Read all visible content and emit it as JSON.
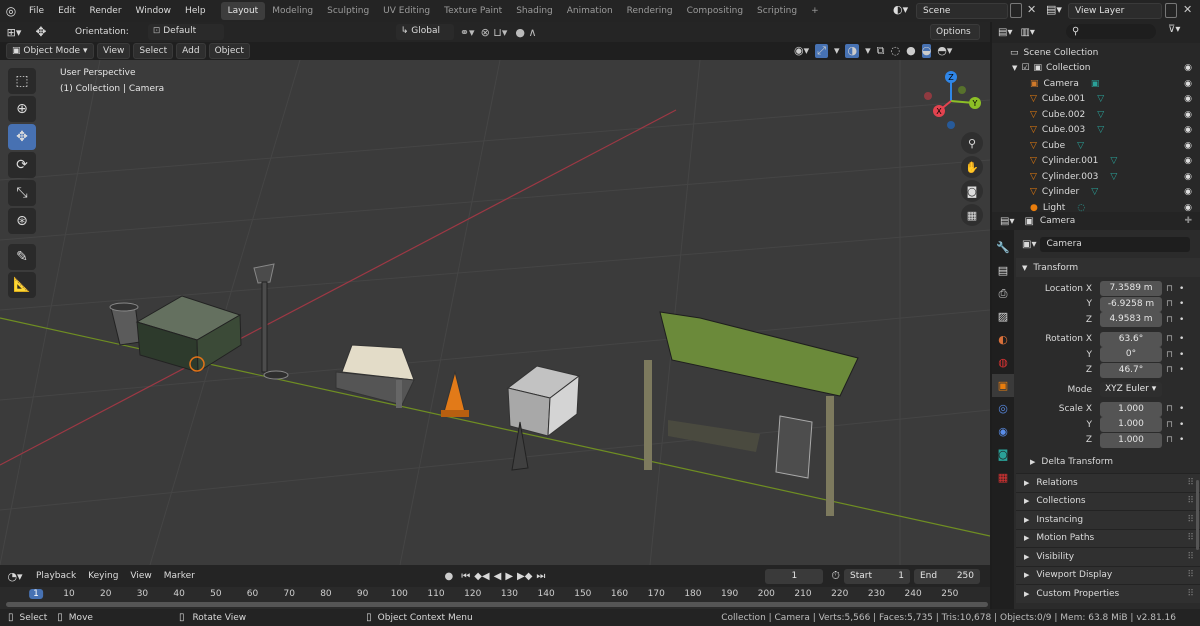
{
  "menu": [
    "File",
    "Edit",
    "Render",
    "Window",
    "Help"
  ],
  "workspaces": [
    "Layout",
    "Modeling",
    "Sculpting",
    "UV Editing",
    "Texture Paint",
    "Shading",
    "Animation",
    "Rendering",
    "Compositing",
    "Scripting"
  ],
  "active_workspace": "Layout",
  "scene": "Scene",
  "view_layer": "View Layer",
  "header": {
    "orientation_label": "Orientation:",
    "orientation_value": "Default",
    "transform_orientation": "Global",
    "options": "Options"
  },
  "mode_bar": {
    "mode": "Object Mode",
    "view": "View",
    "select": "Select",
    "add": "Add",
    "object": "Object"
  },
  "viewport": {
    "perspective": "User Perspective",
    "context": "(1) Collection | Camera"
  },
  "gizmo": {
    "z": "Z",
    "y": "Y",
    "x": "X"
  },
  "timeline": {
    "menus": [
      "Playback",
      "Keying",
      "View",
      "Marker"
    ],
    "current_frame": "1",
    "start_label": "Start",
    "start": "1",
    "end_label": "End",
    "end": "250",
    "ticks": [
      "1",
      "10",
      "20",
      "30",
      "40",
      "50",
      "60",
      "70",
      "80",
      "90",
      "100",
      "110",
      "120",
      "130",
      "140",
      "150",
      "160",
      "170",
      "180",
      "190",
      "200",
      "210",
      "220",
      "230",
      "240",
      "250"
    ]
  },
  "status": {
    "select": "Select",
    "move": "Move",
    "rotate": "Rotate View",
    "context_menu": "Object Context Menu",
    "info": "Collection | Camera | Verts:5,566 | Faces:5,735 | Tris:10,678 | Objects:0/9 | Mem: 63.8 MiB | v2.81.16"
  },
  "outliner": {
    "root": "Scene Collection",
    "collection": "Collection",
    "items": [
      {
        "name": "Camera",
        "type": "camera"
      },
      {
        "name": "Cube.001",
        "type": "mesh"
      },
      {
        "name": "Cube.002",
        "type": "mesh"
      },
      {
        "name": "Cube.003",
        "type": "mesh"
      },
      {
        "name": "Cube",
        "type": "mesh"
      },
      {
        "name": "Cylinder.001",
        "type": "mesh"
      },
      {
        "name": "Cylinder.003",
        "type": "mesh"
      },
      {
        "name": "Cylinder",
        "type": "mesh"
      },
      {
        "name": "Light",
        "type": "light"
      }
    ]
  },
  "properties": {
    "header_object": "Camera",
    "object_name": "Camera",
    "transform_label": "Transform",
    "location_label": "Location X",
    "location": [
      "7.3589 m",
      "-6.9258 m",
      "4.9583 m"
    ],
    "rotation_label": "Rotation X",
    "rotation": [
      "63.6°",
      "0°",
      "46.7°"
    ],
    "mode_label": "Mode",
    "mode_value": "XYZ Euler",
    "scale_label": "Scale X",
    "scale": [
      "1.000",
      "1.000",
      "1.000"
    ],
    "axis_y": "Y",
    "axis_z": "Z",
    "delta": "Delta Transform",
    "sections": [
      "Relations",
      "Collections",
      "Instancing",
      "Motion Paths",
      "Visibility",
      "Viewport Display",
      "Custom Properties"
    ]
  },
  "colors": {
    "accent": "#4772b3",
    "mesh_icon": "#e87d0d",
    "axis_x": "#e3434f",
    "axis_y": "#8cbf26",
    "axis_z": "#2f86e8"
  }
}
